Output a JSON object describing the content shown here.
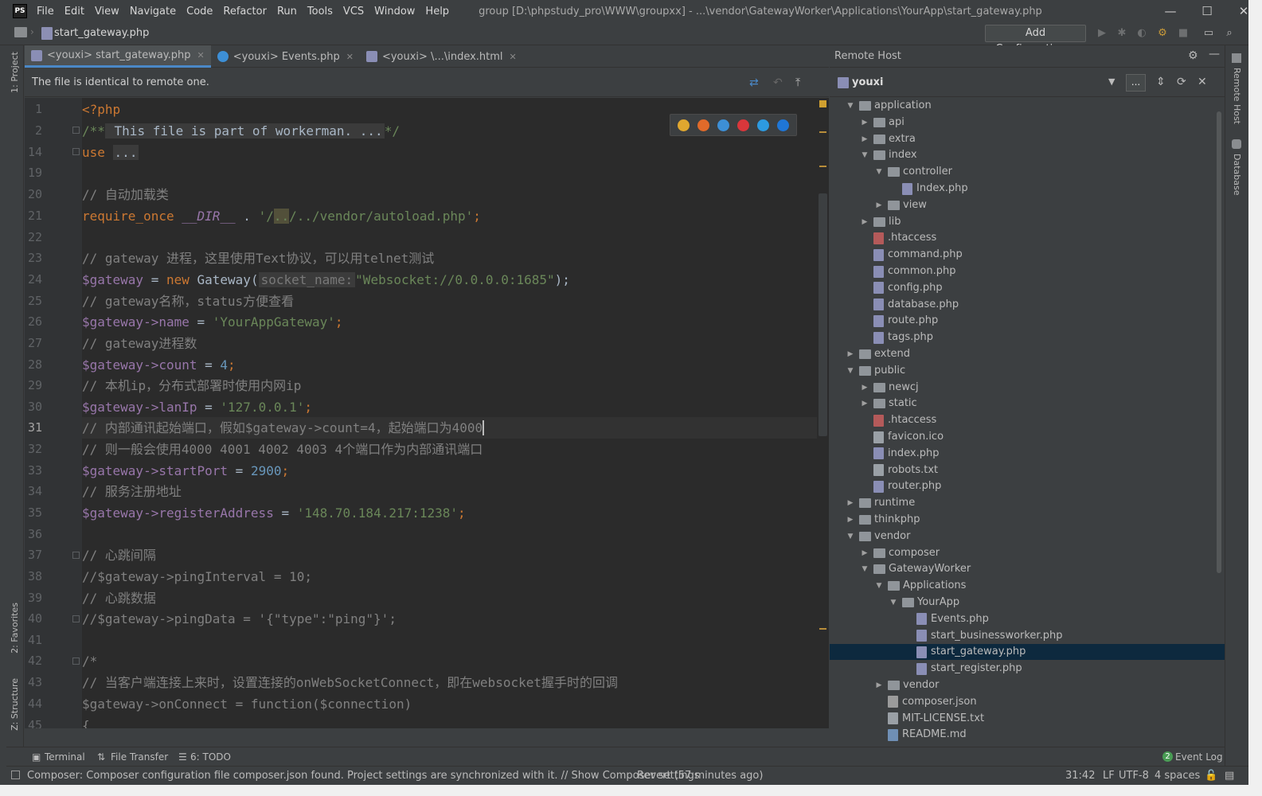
{
  "title_bar": {
    "menu": [
      "File",
      "Edit",
      "View",
      "Navigate",
      "Code",
      "Refactor",
      "Run",
      "Tools",
      "VCS",
      "Window",
      "Help"
    ],
    "window_title": "group [D:\\phpstudy_pro\\WWW\\groupxx] - ...\\vendor\\GatewayWorker\\Applications\\YourApp\\start_gateway.php",
    "controls": [
      "—",
      "☐",
      "✕"
    ]
  },
  "nav": {
    "path": "start_gateway.php",
    "add_configuration": "Add Configuration..."
  },
  "left_tools": {
    "project": "1: Project",
    "favorites": "2: Favorites",
    "structure": "Z: Structure"
  },
  "tabs": [
    {
      "label": "<youxi> start_gateway.php",
      "active": true,
      "icon_color": "#8a8eb5"
    },
    {
      "label": "<youxi> Events.php",
      "active": false,
      "icon_color": "#3d8fd6"
    },
    {
      "label": "<youxi> \\...\\index.html",
      "active": false,
      "icon_color": "#8a8eb5"
    }
  ],
  "notice": "The file is identical to remote one.",
  "editor": {
    "line_numbers": [
      "1",
      "2",
      "14",
      "19",
      "20",
      "21",
      "22",
      "23",
      "24",
      "25",
      "26",
      "27",
      "28",
      "29",
      "30",
      "31",
      "32",
      "33",
      "34",
      "35",
      "36",
      "37",
      "38",
      "39",
      "40",
      "41",
      "42",
      "43",
      "44",
      "45"
    ],
    "current_line": "31",
    "lines": {
      "l1": "<?php",
      "l2_open": "/**",
      "l2_folded": " This file is part of workerman. ...",
      "l2_close": "*/",
      "l14_kw": "use",
      "l14_folded": "...",
      "l20": "// 自动加载类",
      "l21_kw": "require_once",
      "l21_const": "__DIR__",
      "l21_op": " . ",
      "l21_s1": "'/",
      "l21_s2": "..",
      "l21_s3": "/../vendor/autoload.php'",
      "l21_end": ";",
      "l23": "// gateway 进程，这里使用Text协议，可以用telnet测试",
      "l24_var": "$gateway",
      "l24_mid": " = ",
      "l24_new": "new",
      "l24_cls": " Gateway(",
      "l24_hint": "socket_name:",
      "l24_str": "\"Websocket://0.0.0.0:1685\"",
      "l24_end": ");",
      "l25": "// gateway名称，status方便查看",
      "l26_var": "$gateway",
      "l26_prop": "->name",
      "l26_eq": " = ",
      "l26_str": "'YourAppGateway'",
      "l26_end": ";",
      "l27": "// gateway进程数",
      "l28_var": "$gateway",
      "l28_prop": "->count",
      "l28_eq": " = ",
      "l28_num": "4",
      "l28_end": ";",
      "l29": "// 本机ip，分布式部署时使用内网ip",
      "l30_var": "$gateway",
      "l30_prop": "->lanIp",
      "l30_eq": " = ",
      "l30_str": "'127.0.0.1'",
      "l30_end": ";",
      "l31": "// 内部通讯起始端口，假如$gateway->count=4，起始端口为4000",
      "l32": "// 则一般会使用4000 4001 4002 4003 4个端口作为内部通讯端口",
      "l33_var": "$gateway",
      "l33_prop": "->startPort",
      "l33_eq": " = ",
      "l33_num": "2900",
      "l33_end": ";",
      "l34": "// 服务注册地址",
      "l35_var": "$gateway",
      "l35_prop": "->registerAddress",
      "l35_eq": " = ",
      "l35_str": "'148.70.184.217:1238'",
      "l35_end": ";",
      "l37": "// 心跳间隔",
      "l38": "//$gateway->pingInterval = 10;",
      "l39": "// 心跳数据",
      "l40": "//$gateway->pingData = '{\"type\":\"ping\"}';",
      "l42": "/*",
      "l43": "// 当客户端连接上来时，设置连接的onWebSocketConnect，即在websocket握手时的回调",
      "l44": "$gateway->onConnect = function($connection)",
      "l45": "{"
    },
    "browser_icons": [
      "chrome-icon",
      "firefox-icon",
      "safari-icon",
      "opera-icon",
      "ie-icon",
      "edge-icon"
    ]
  },
  "remote_host": {
    "title": "Remote Host",
    "server": "youxi",
    "more_button": "...",
    "tree": [
      {
        "label": "application",
        "type": "folder",
        "expanded": true,
        "depth": 0
      },
      {
        "label": "api",
        "type": "folder",
        "expanded": false,
        "depth": 1
      },
      {
        "label": "extra",
        "type": "folder",
        "expanded": false,
        "depth": 1
      },
      {
        "label": "index",
        "type": "folder",
        "expanded": true,
        "depth": 1
      },
      {
        "label": "controller",
        "type": "folder",
        "expanded": true,
        "depth": 2
      },
      {
        "label": "Index.php",
        "type": "php",
        "depth": 3
      },
      {
        "label": "view",
        "type": "folder",
        "expanded": false,
        "depth": 2
      },
      {
        "label": "lib",
        "type": "folder",
        "expanded": false,
        "depth": 1
      },
      {
        "label": ".htaccess",
        "type": "ht",
        "depth": 1
      },
      {
        "label": "command.php",
        "type": "php",
        "depth": 1
      },
      {
        "label": "common.php",
        "type": "php",
        "depth": 1
      },
      {
        "label": "config.php",
        "type": "php",
        "depth": 1
      },
      {
        "label": "database.php",
        "type": "php",
        "depth": 1
      },
      {
        "label": "route.php",
        "type": "php",
        "depth": 1
      },
      {
        "label": "tags.php",
        "type": "php",
        "depth": 1
      },
      {
        "label": "extend",
        "type": "folder",
        "expanded": false,
        "depth": 0
      },
      {
        "label": "public",
        "type": "folder",
        "expanded": true,
        "depth": 0
      },
      {
        "label": "newcj",
        "type": "folder",
        "expanded": false,
        "depth": 1
      },
      {
        "label": "static",
        "type": "folder",
        "expanded": false,
        "depth": 1
      },
      {
        "label": ".htaccess",
        "type": "ht",
        "depth": 1
      },
      {
        "label": "favicon.ico",
        "type": "txt",
        "depth": 1
      },
      {
        "label": "index.php",
        "type": "php",
        "depth": 1
      },
      {
        "label": "robots.txt",
        "type": "txt",
        "depth": 1
      },
      {
        "label": "router.php",
        "type": "php",
        "depth": 1
      },
      {
        "label": "runtime",
        "type": "folder",
        "expanded": false,
        "depth": 0
      },
      {
        "label": "thinkphp",
        "type": "folder",
        "expanded": false,
        "depth": 0
      },
      {
        "label": "vendor",
        "type": "folder",
        "expanded": true,
        "depth": 0
      },
      {
        "label": "composer",
        "type": "folder",
        "expanded": false,
        "depth": 1
      },
      {
        "label": "GatewayWorker",
        "type": "folder",
        "expanded": true,
        "depth": 1
      },
      {
        "label": "Applications",
        "type": "folder",
        "expanded": true,
        "depth": 2
      },
      {
        "label": "YourApp",
        "type": "folder",
        "expanded": true,
        "depth": 3
      },
      {
        "label": "Events.php",
        "type": "php",
        "depth": 4
      },
      {
        "label": "start_businessworker.php",
        "type": "php",
        "depth": 4
      },
      {
        "label": "start_gateway.php",
        "type": "php",
        "depth": 4,
        "selected": true
      },
      {
        "label": "start_register.php",
        "type": "php",
        "depth": 4
      },
      {
        "label": "vendor",
        "type": "folder",
        "expanded": false,
        "depth": 2
      },
      {
        "label": "composer.json",
        "type": "json",
        "depth": 2
      },
      {
        "label": "MIT-LICENSE.txt",
        "type": "txt",
        "depth": 2
      },
      {
        "label": "README.md",
        "type": "md",
        "depth": 2
      }
    ]
  },
  "right_tools": {
    "remote_host": "Remote Host",
    "database": "Database"
  },
  "bottom_tools": {
    "terminal": "Terminal",
    "file_transfer": "File Transfer",
    "todo": "6: TODO",
    "event_log": "Event Log",
    "event_count": "2"
  },
  "status": {
    "message": "Composer: Composer configuration file composer.json found. Project settings are synchronized with it. // Show Composer settings",
    "revert": "Revert (57 minutes ago)",
    "position": "31:42",
    "line_sep": "LF",
    "encoding": "UTF-8",
    "indent": "4 spaces"
  }
}
